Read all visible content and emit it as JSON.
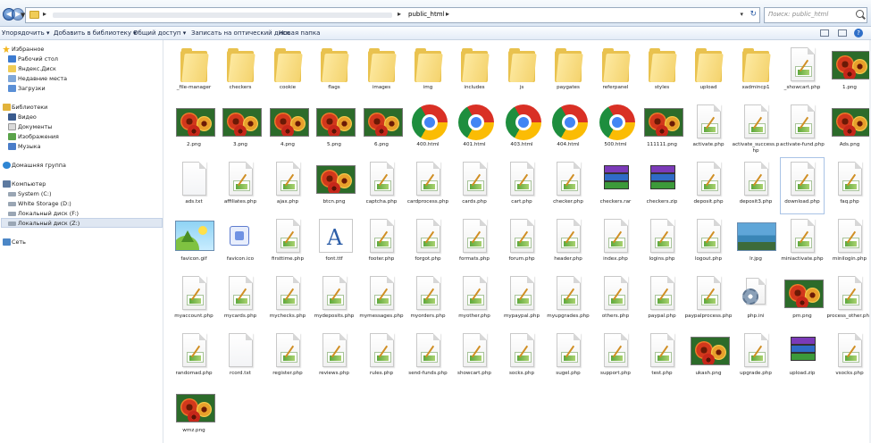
{
  "address": {
    "path": "public_html",
    "search_placeholder": "Поиск: public_html"
  },
  "toolbar": {
    "organize": "Упорядочить",
    "library": "Добавить в библиотеку",
    "share": "Общий доступ",
    "burn": "Записать на оптический диск",
    "new_folder": "Новая папка"
  },
  "nav": {
    "favorites": {
      "label": "Избранное",
      "items": [
        "Рабочий стол",
        "Яндекс.Диск",
        "Недавние места",
        "Загрузки"
      ]
    },
    "libraries": {
      "label": "Библиотеки",
      "items": [
        "Видео",
        "Документы",
        "Изображения",
        "Музыка"
      ]
    },
    "homegroup": "Домашняя группа",
    "computer": {
      "label": "Компьютер",
      "items": [
        "System (C:)",
        "White Storage (D:)",
        "Локальный диск (F:)",
        "Локальный диск (Z:)"
      ],
      "selected": 3
    },
    "network": "Сеть"
  },
  "files": [
    {
      "name": "_file-manager",
      "type": "folder"
    },
    {
      "name": "checkers",
      "type": "folder"
    },
    {
      "name": "cookie",
      "type": "folder"
    },
    {
      "name": "flags",
      "type": "folder"
    },
    {
      "name": "images",
      "type": "folder"
    },
    {
      "name": "img",
      "type": "folder"
    },
    {
      "name": "includes",
      "type": "folder"
    },
    {
      "name": "js",
      "type": "folder"
    },
    {
      "name": "paygates",
      "type": "folder"
    },
    {
      "name": "referpanel",
      "type": "folder"
    },
    {
      "name": "styles",
      "type": "folder"
    },
    {
      "name": "upload",
      "type": "folder"
    },
    {
      "name": "xadmincp1",
      "type": "folder"
    },
    {
      "name": "_showcart.php",
      "type": "php"
    },
    {
      "name": "1.png",
      "type": "png"
    },
    {
      "name": "2.png",
      "type": "png"
    },
    {
      "name": "3.png",
      "type": "png"
    },
    {
      "name": "4.png",
      "type": "png"
    },
    {
      "name": "5.png",
      "type": "png"
    },
    {
      "name": "6.png",
      "type": "png"
    },
    {
      "name": "400.html",
      "type": "html"
    },
    {
      "name": "401.html",
      "type": "html"
    },
    {
      "name": "403.html",
      "type": "html"
    },
    {
      "name": "404.html",
      "type": "html"
    },
    {
      "name": "500.html",
      "type": "html"
    },
    {
      "name": "111111.png",
      "type": "png"
    },
    {
      "name": "activate.php",
      "type": "php"
    },
    {
      "name": "activate_success.php",
      "type": "php"
    },
    {
      "name": "activate-fund.php",
      "type": "php"
    },
    {
      "name": "Ads.png",
      "type": "png"
    },
    {
      "name": "ads.txt",
      "type": "txt"
    },
    {
      "name": "affiliates.php",
      "type": "php"
    },
    {
      "name": "ajax.php",
      "type": "php"
    },
    {
      "name": "btcn.png",
      "type": "png"
    },
    {
      "name": "captcha.php",
      "type": "php"
    },
    {
      "name": "cardprocess.php",
      "type": "php"
    },
    {
      "name": "cards.php",
      "type": "php"
    },
    {
      "name": "cart.php",
      "type": "php"
    },
    {
      "name": "checker.php",
      "type": "php"
    },
    {
      "name": "checkers.rar",
      "type": "rar"
    },
    {
      "name": "checkers.zip",
      "type": "rar"
    },
    {
      "name": "deposit.php",
      "type": "php"
    },
    {
      "name": "deposit3.php",
      "type": "php"
    },
    {
      "name": "download.php",
      "type": "php"
    },
    {
      "name": "faq.php",
      "type": "php"
    },
    {
      "name": "favicon.gif",
      "type": "gif"
    },
    {
      "name": "favicon.ico",
      "type": "ico"
    },
    {
      "name": "firsttime.php",
      "type": "php"
    },
    {
      "name": "font.ttf",
      "type": "ttf"
    },
    {
      "name": "footer.php",
      "type": "php"
    },
    {
      "name": "forgot.php",
      "type": "php"
    },
    {
      "name": "formats.php",
      "type": "php"
    },
    {
      "name": "forum.php",
      "type": "php"
    },
    {
      "name": "header.php",
      "type": "php"
    },
    {
      "name": "index.php",
      "type": "php"
    },
    {
      "name": "logins.php",
      "type": "php"
    },
    {
      "name": "logout.php",
      "type": "php"
    },
    {
      "name": "lr.jpg",
      "type": "jpg"
    },
    {
      "name": "miniactivate.php",
      "type": "php"
    },
    {
      "name": "minilogin.php",
      "type": "php"
    },
    {
      "name": "myaccount.php",
      "type": "php"
    },
    {
      "name": "mycards.php",
      "type": "php"
    },
    {
      "name": "mychecks.php",
      "type": "php"
    },
    {
      "name": "mydeposits.php",
      "type": "php"
    },
    {
      "name": "mymessages.php",
      "type": "php"
    },
    {
      "name": "myorders.php",
      "type": "php"
    },
    {
      "name": "myother.php",
      "type": "php"
    },
    {
      "name": "mypaypal.php",
      "type": "php"
    },
    {
      "name": "myupgrades.php",
      "type": "php"
    },
    {
      "name": "others.php",
      "type": "php"
    },
    {
      "name": "paypal.php",
      "type": "php"
    },
    {
      "name": "paypalprocess.php",
      "type": "php"
    },
    {
      "name": "php.ini",
      "type": "ini"
    },
    {
      "name": "pm.png",
      "type": "png"
    },
    {
      "name": "process_other.php",
      "type": "php"
    },
    {
      "name": "randomad.php",
      "type": "php"
    },
    {
      "name": "rcord.txt",
      "type": "txt"
    },
    {
      "name": "register.php",
      "type": "php"
    },
    {
      "name": "reviews.php",
      "type": "php"
    },
    {
      "name": "rules.php",
      "type": "php"
    },
    {
      "name": "send-funds.php",
      "type": "php"
    },
    {
      "name": "showcart.php",
      "type": "php"
    },
    {
      "name": "socks.php",
      "type": "php"
    },
    {
      "name": "sugel.php",
      "type": "php"
    },
    {
      "name": "support.php",
      "type": "php"
    },
    {
      "name": "test.php",
      "type": "php"
    },
    {
      "name": "ukash.png",
      "type": "png"
    },
    {
      "name": "upgrade.php",
      "type": "php"
    },
    {
      "name": "upload.zip",
      "type": "rar"
    },
    {
      "name": "vsocks.php",
      "type": "php"
    },
    {
      "name": "wmz.png",
      "type": "png"
    }
  ]
}
